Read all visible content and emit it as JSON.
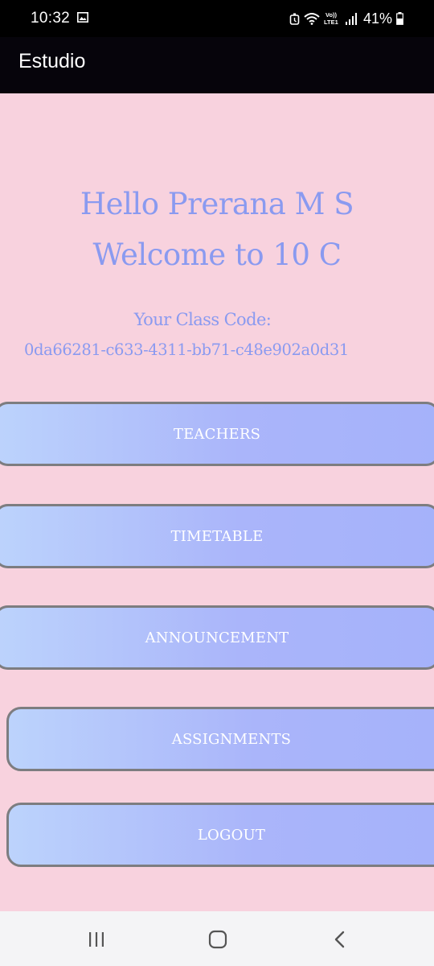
{
  "status_bar": {
    "time": "10:32",
    "battery": "41%",
    "network": "VoLTE1",
    "icons": [
      "gallery-icon",
      "alarm-icon",
      "wifi-icon",
      "volte-icon",
      "signal-icon",
      "battery-icon"
    ]
  },
  "app_bar": {
    "title": "Estudio"
  },
  "main": {
    "greeting": "Hello Prerana M S",
    "welcome": "Welcome to 10 C",
    "class_code_label": "Your Class Code:",
    "class_code": "0da66281-c633-4311-bb71-c48e902a0d31",
    "buttons": {
      "teachers": "TEACHERS",
      "timetable": "TIMETABLE",
      "announcement": "ANNOUNCEMENT",
      "assignments": "ASSIGNMENTS",
      "logout": "LOGOUT"
    }
  },
  "nav_bar": {
    "icons": [
      "recent-apps-icon",
      "home-icon",
      "back-icon"
    ]
  },
  "colors": {
    "background": "#f8d2de",
    "header": "#06040b",
    "text_accent": "#8a9af0",
    "button_start": "#bcd3fc",
    "button_end": "#a5b2fa",
    "button_border": "#7d7d80"
  }
}
